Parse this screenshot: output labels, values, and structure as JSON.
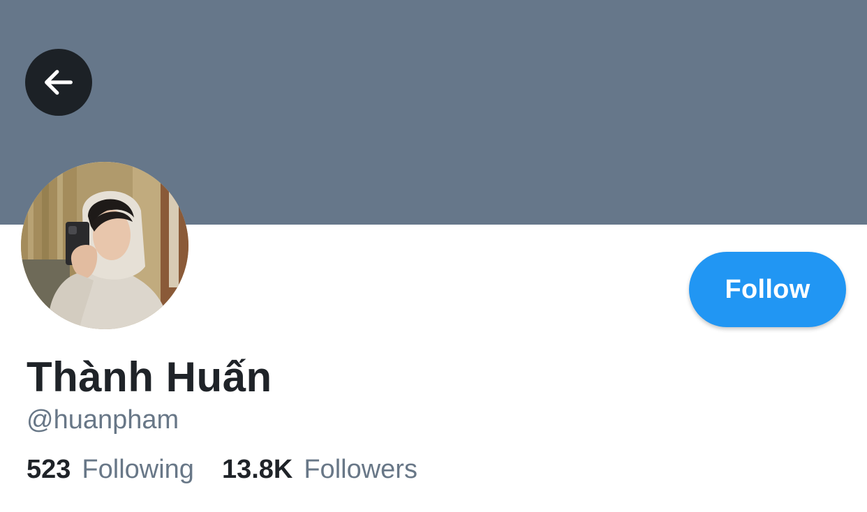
{
  "colors": {
    "banner": "#66778a",
    "back_button_bg": "#1c2126",
    "follow_button": "#2196f3",
    "secondary_text": "#687787",
    "primary_text": "#1f2328"
  },
  "header": {
    "back_icon": "arrow-left-icon"
  },
  "profile": {
    "avatar_icon": "profile-photo",
    "display_name": "Thành Huấn",
    "handle": "@huanpham",
    "follow_label": "Follow",
    "stats": {
      "following_count": "523",
      "following_label": "Following",
      "followers_count": "13.8K",
      "followers_label": "Followers"
    }
  }
}
